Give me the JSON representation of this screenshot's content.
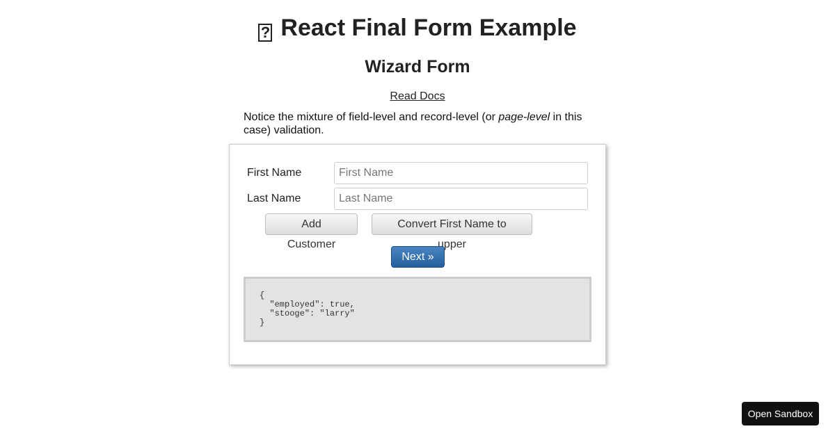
{
  "header": {
    "icon": "missing-glyph-icon",
    "icon_char": "?",
    "title": "React Final Form Example",
    "subtitle": "Wizard Form",
    "docs_link": "Read Docs"
  },
  "notice": {
    "before": "Notice the mixture of field-level and record-level (or ",
    "emphasis": "page-level",
    "after": " in this case) validation."
  },
  "form": {
    "first_name": {
      "label": "First Name",
      "placeholder": "First Name",
      "value": ""
    },
    "last_name": {
      "label": "Last Name",
      "placeholder": "Last Name",
      "value": ""
    },
    "add_customer_label": "Add Customer",
    "convert_label": "Convert First Name to upper",
    "next_label": "Next »",
    "values_json": "{\n  \"employed\": true,\n  \"stooge\": \"larry\"\n}"
  },
  "sandbox": {
    "label": "Open Sandbox"
  }
}
